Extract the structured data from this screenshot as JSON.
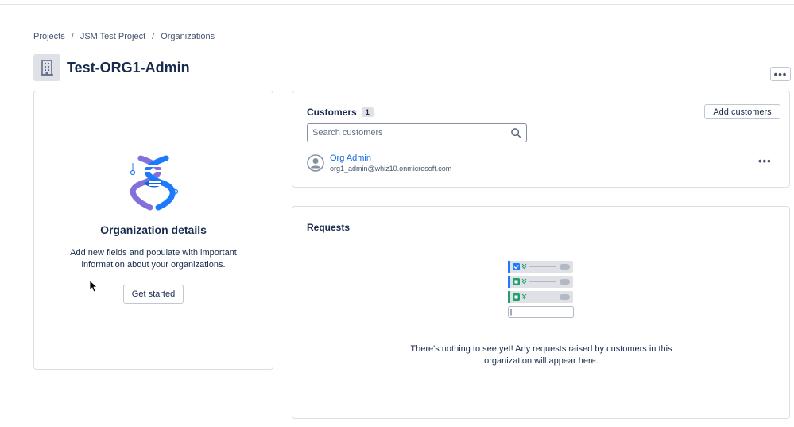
{
  "breadcrumb": {
    "items": [
      "Projects",
      "JSM Test Project",
      "Organizations"
    ],
    "separator": "/"
  },
  "page": {
    "title": "Test-ORG1-Admin",
    "more_label": "•••"
  },
  "org_details": {
    "title": "Organization details",
    "description": "Add new fields and populate with important information about your organizations.",
    "button_label": "Get started"
  },
  "customers": {
    "title": "Customers",
    "count": "1",
    "add_button_label": "Add customers",
    "search_placeholder": "Search customers",
    "search_value": "",
    "list": [
      {
        "name": "Org Admin",
        "email": "org1_admin@whiz10.onmicrosoft.com",
        "more_label": "•••"
      }
    ]
  },
  "requests": {
    "title": "Requests",
    "empty_message": "There's nothing to see yet! Any requests raised by customers in this organization will appear here."
  },
  "colors": {
    "link": "#0c66e4",
    "text": "#172b4d",
    "border": "#dcdfe4",
    "illustration_blue": "#1d7afc",
    "illustration_green": "#22a06b",
    "illustration_purple": "#8270db"
  },
  "icons": {
    "org": "building-icon",
    "search": "search-icon",
    "user": "user-avatar-icon",
    "more": "more-horizontal-icon",
    "dna": "dna-illustration",
    "requests": "requests-list-illustration"
  }
}
